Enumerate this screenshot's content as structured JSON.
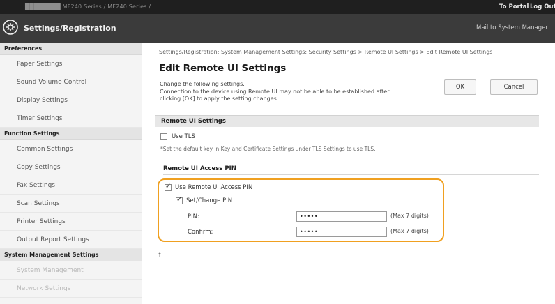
{
  "topbar": {
    "device_crumb": "████████      MF240 Series / MF240 Series /",
    "portal_link": "To Portal",
    "logout_link": "Log Out"
  },
  "header": {
    "title": "Settings/Registration",
    "mail_link": "Mail to System Manager"
  },
  "sidebar": {
    "sections": [
      {
        "label": "Preferences"
      },
      {
        "label": "Function Settings"
      },
      {
        "label": "System Management Settings"
      }
    ],
    "items": [
      {
        "label": "Paper Settings"
      },
      {
        "label": "Sound Volume Control"
      },
      {
        "label": "Display Settings"
      },
      {
        "label": "Timer Settings"
      },
      {
        "label": "Common Settings"
      },
      {
        "label": "Copy Settings"
      },
      {
        "label": "Fax Settings"
      },
      {
        "label": "Scan Settings"
      },
      {
        "label": "Printer Settings"
      },
      {
        "label": "Output Report Settings"
      },
      {
        "label": "System Management"
      },
      {
        "label": "Network Settings"
      }
    ]
  },
  "main": {
    "breadcrumb": "Settings/Registration: System Management Settings: Security Settings > Remote UI Settings > Edit Remote UI Settings",
    "page_title": "Edit Remote UI Settings",
    "description": [
      "Change the following settings.",
      "Connection to the device using Remote UI may not be able to be established after",
      "clicking [OK] to apply the setting changes."
    ],
    "ok_button": "OK",
    "cancel_button": "Cancel",
    "remote_ui_section": "Remote UI Settings",
    "use_tls_label": "Use TLS",
    "use_tls_checked": false,
    "tls_note": "*Set the default key in Key and Certificate Settings under TLS Settings to use TLS.",
    "pin_section": "Remote UI Access PIN",
    "use_pin_label": "Use Remote UI Access PIN",
    "use_pin_checked": true,
    "set_change_pin_label": "Set/Change PIN",
    "set_change_pin_checked": true,
    "pin_label": "PIN:",
    "pin_value": "•••••",
    "pin_hint": "(Max 7 digits)",
    "confirm_label": "Confirm:",
    "confirm_value": "•••••",
    "confirm_hint": "(Max 7 digits)",
    "highlight_color": "#f0a020"
  }
}
